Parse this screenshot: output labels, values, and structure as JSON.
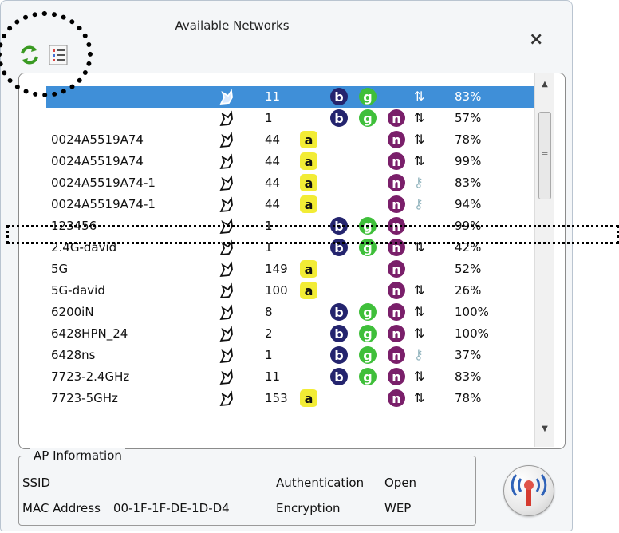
{
  "window": {
    "title": "Available Networks",
    "close_label": "×"
  },
  "toolbar": {
    "refresh_icon": "refresh-icon",
    "list_icon": "list-icon"
  },
  "networks": [
    {
      "ssid": "",
      "channel": "11",
      "modes": [
        "b",
        "g"
      ],
      "encryption_icon": "encryption-icon",
      "signal": "83%",
      "selected": true
    },
    {
      "ssid": "",
      "channel": "1",
      "modes": [
        "b",
        "g",
        "n"
      ],
      "encryption_icon": "encryption-icon",
      "signal": "57%"
    },
    {
      "ssid": "0024A5519A74",
      "channel": "44",
      "modes": [
        "a",
        "n"
      ],
      "encryption_icon": "encryption-icon",
      "signal": "78%"
    },
    {
      "ssid": "0024A5519A74",
      "channel": "44",
      "modes": [
        "a",
        "n"
      ],
      "encryption_icon": "encryption-icon",
      "signal": "99%"
    },
    {
      "ssid": "0024A5519A74-1",
      "channel": "44",
      "modes": [
        "a",
        "n"
      ],
      "encryption_icon": "key-icon",
      "signal": "83%"
    },
    {
      "ssid": "0024A5519A74-1",
      "channel": "44",
      "modes": [
        "a",
        "n"
      ],
      "encryption_icon": "key-icon",
      "signal": "94%"
    },
    {
      "ssid": "123456",
      "channel": "1",
      "modes": [
        "b",
        "g",
        "n"
      ],
      "encryption_icon": "",
      "signal": "99%"
    },
    {
      "ssid": "2.4G-david",
      "channel": "1",
      "modes": [
        "b",
        "g",
        "n"
      ],
      "encryption_icon": "encryption-icon",
      "signal": "42%"
    },
    {
      "ssid": "5G",
      "channel": "149",
      "modes": [
        "a",
        "n"
      ],
      "encryption_icon": "",
      "signal": "52%"
    },
    {
      "ssid": "5G-david",
      "channel": "100",
      "modes": [
        "a",
        "n"
      ],
      "encryption_icon": "encryption-icon",
      "signal": "26%"
    },
    {
      "ssid": "6200iN",
      "channel": "8",
      "modes": [
        "b",
        "g",
        "n"
      ],
      "encryption_icon": "encryption-icon",
      "signal": "100%"
    },
    {
      "ssid": "6428HPN_24",
      "channel": "2",
      "modes": [
        "b",
        "g",
        "n"
      ],
      "encryption_icon": "encryption-icon",
      "signal": "100%"
    },
    {
      "ssid": "6428ns",
      "channel": "1",
      "modes": [
        "b",
        "g",
        "n"
      ],
      "encryption_icon": "key-icon",
      "signal": "37%"
    },
    {
      "ssid": "7723-2.4GHz",
      "channel": "11",
      "modes": [
        "b",
        "g",
        "n"
      ],
      "encryption_icon": "encryption-icon",
      "signal": "83%"
    },
    {
      "ssid": "7723-5GHz",
      "channel": "153",
      "modes": [
        "a",
        "n"
      ],
      "encryption_icon": "encryption-icon",
      "signal": "78%"
    }
  ],
  "ap_info": {
    "legend": "AP Information",
    "ssid_label": "SSID",
    "ssid_value": "",
    "mac_label": "MAC Address",
    "mac_value": "00-1F-1F-DE-1D-D4",
    "auth_label": "Authentication",
    "auth_value": "Open",
    "enc_label": "Encryption",
    "enc_value": "WEP"
  },
  "colors": {
    "selected_row": "#3f8fd8",
    "mode_a": "#f2ec35",
    "mode_b": "#24246e",
    "mode_g": "#3fbf3a",
    "mode_n": "#7a1f6a"
  }
}
